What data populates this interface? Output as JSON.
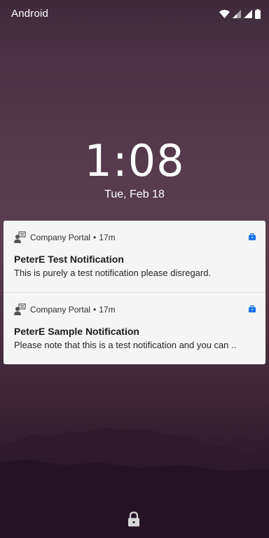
{
  "status_bar": {
    "carrier": "Android",
    "icons": [
      "wifi-icon",
      "signal-icon",
      "signal-icon",
      "battery-icon"
    ]
  },
  "lockscreen": {
    "time": "1:08",
    "date": "Tue, Feb 18"
  },
  "notifications": [
    {
      "app_name": "Company Portal",
      "separator": "•",
      "time_ago": "17m",
      "title": "PeterE Test Notification",
      "body": "This is purely a test notification please disregard.",
      "app_icon": "company-portal-icon",
      "badge_icon": "work-profile-icon"
    },
    {
      "app_name": "Company Portal",
      "separator": "•",
      "time_ago": "17m",
      "title": "PeterE Sample Notification",
      "body": "Please note that this is a test notification and you can ..",
      "app_icon": "company-portal-icon",
      "badge_icon": "work-profile-icon"
    }
  ],
  "bottom": {
    "icon": "lock-icon"
  },
  "colors": {
    "notification_bg": "#f5f5f5",
    "work_badge": "#1a73e8",
    "text_primary": "#1a1a1a"
  }
}
